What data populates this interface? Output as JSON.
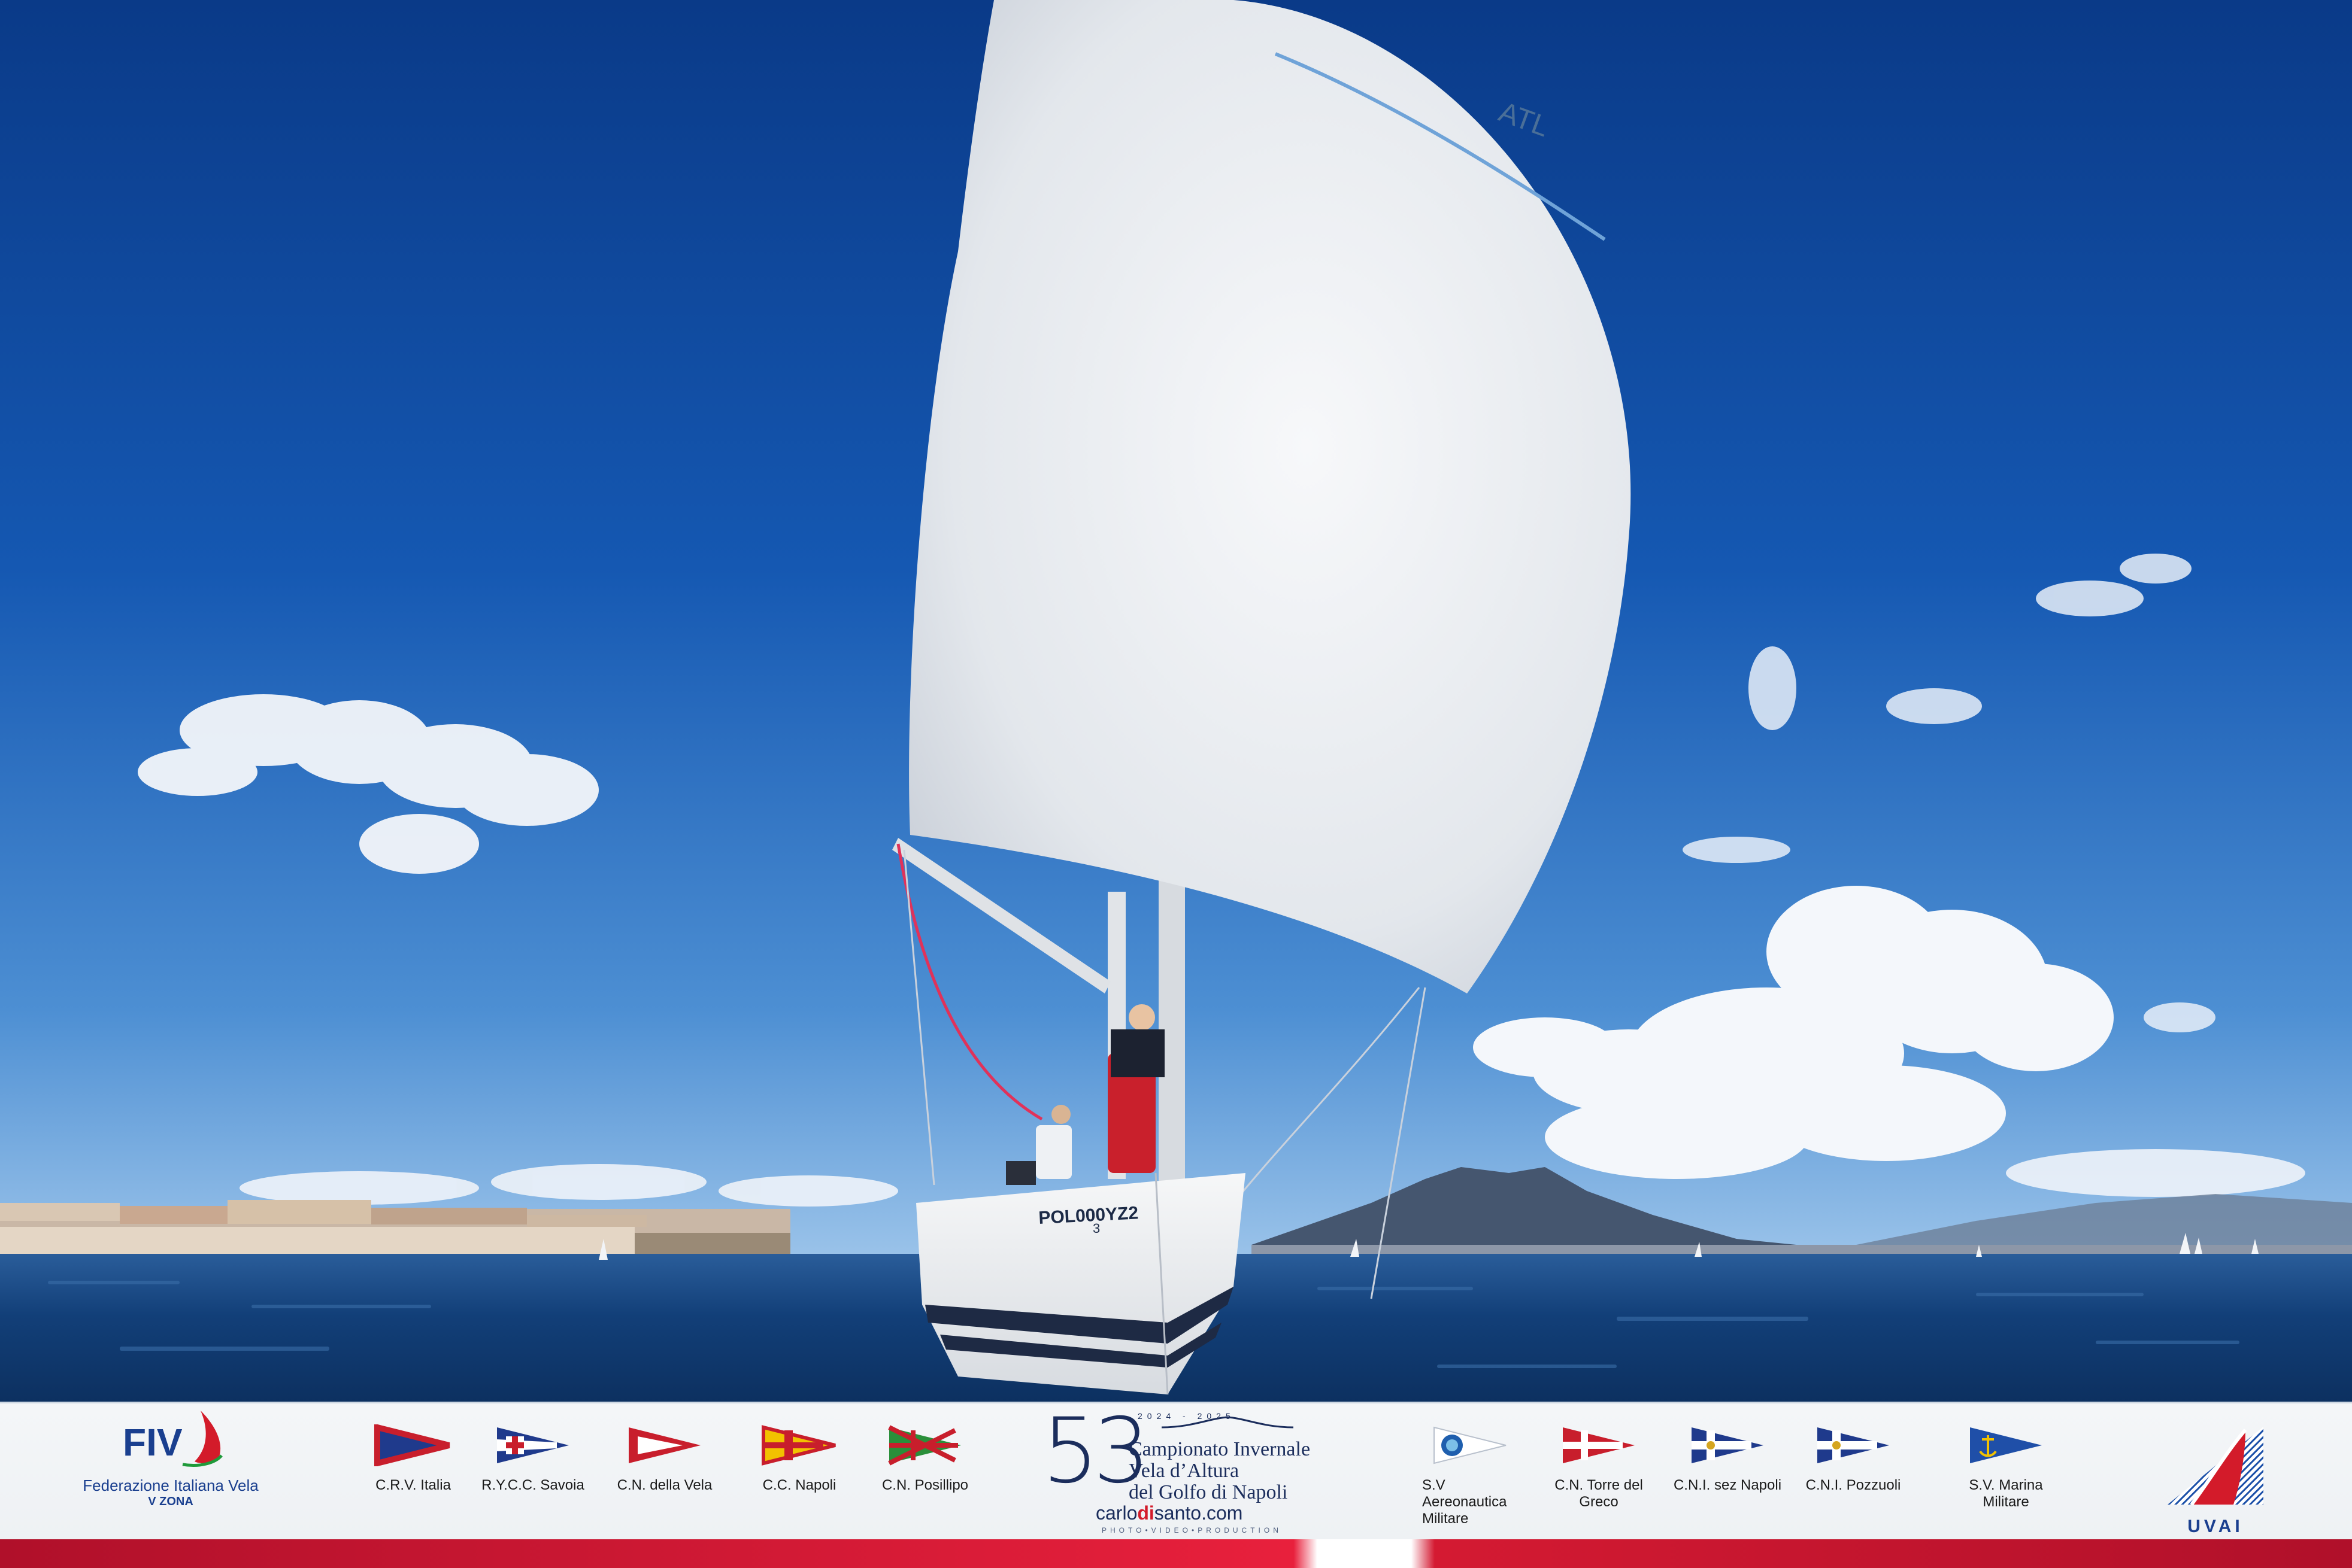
{
  "photo": {
    "boat_sail_number": "POL000YZ2",
    "boat_bow_number": "3",
    "spinnaker_text": "ATL"
  },
  "footer": {
    "federation": {
      "logo_text": "FIV",
      "name": "Federazione Italiana Vela",
      "zone": "V ZONA"
    },
    "clubs_left": [
      {
        "label": "C.R.V. Italia",
        "flag": "crv-italia-flag-icon"
      },
      {
        "label": "R.Y.C.C. Savoia",
        "flag": "rycc-savoia-flag-icon"
      },
      {
        "label": "C.N. della Vela",
        "flag": "cn-della-vela-flag-icon"
      },
      {
        "label": "C.C. Napoli",
        "flag": "cc-napoli-flag-icon"
      },
      {
        "label": "C.N. Posillipo",
        "flag": "cn-posillipo-flag-icon"
      }
    ],
    "event": {
      "edition": "53",
      "years": "2024 - 2025",
      "line1": "Campionato Invernale",
      "line2": "Vela d’Altura",
      "line3": "del Golfo di Napoli",
      "credit_prefix": "carlo",
      "credit_highlight": "di",
      "credit_suffix": "santo.com",
      "credit_sub": "PHOTO•VIDEO•PRODUCTION"
    },
    "clubs_right": [
      {
        "label": "S.V Aereonautica Militare",
        "flag": "sv-aeronautica-flag-icon"
      },
      {
        "label": "C.N. Torre del Greco",
        "flag": "cn-torre-del-greco-flag-icon"
      },
      {
        "label": "C.N.I. sez Napoli",
        "flag": "cni-napoli-flag-icon"
      },
      {
        "label": "C.N.I. Pozzuoli",
        "flag": "cni-pozzuoli-flag-icon"
      },
      {
        "label": "S.V. Marina Militare",
        "flag": "sv-marina-militare-flag-icon"
      }
    ],
    "uvai": {
      "text": "UVAI"
    }
  },
  "colors": {
    "sky_top": "#0b3f8f",
    "sky_bottom": "#5b9ad6",
    "sea": "#0f3f7a",
    "accent_red": "#d31b2a",
    "navy": "#1b2d5c"
  }
}
